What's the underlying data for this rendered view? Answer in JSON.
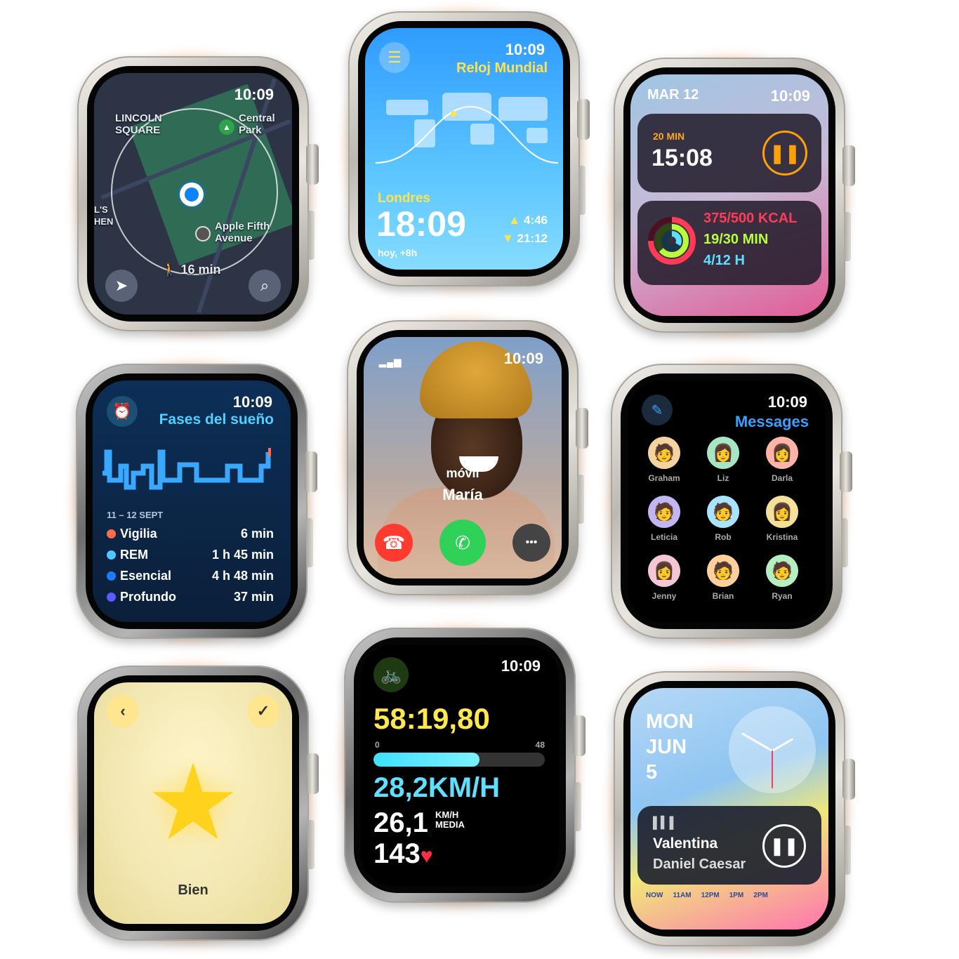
{
  "watches": {
    "maps": {
      "time": "10:09",
      "labels": [
        "LINCOLN",
        "SQUARE",
        "Central",
        "Park",
        "Apple Fifth",
        "Avenue",
        "L'S",
        "HEN"
      ],
      "route_time": "16 min",
      "icons": {
        "walk": "walk-icon",
        "locate": "location-arrow-icon",
        "search": "search-icon",
        "park": "park-pin-icon",
        "store": "apple-store-pin-icon"
      }
    },
    "world_clock": {
      "time": "10:09",
      "title": "Reloj Mundial",
      "city": "Londres",
      "city_time": "18:09",
      "offset": "hoy, +8h",
      "sunrise": "4:46",
      "sunset": "21:12"
    },
    "smart_stack": {
      "date": "MAR 12",
      "time": "10:09",
      "timer_label": "20 MIN",
      "timer_value": "15:08",
      "activity": {
        "move": "375/500 KCAL",
        "exercise": "19/30 MIN",
        "stand": "4/12 H"
      },
      "colors": {
        "move": "#ff3b57",
        "exercise": "#b8ff3b",
        "stand": "#5be1ff"
      }
    },
    "sleep": {
      "time": "10:09",
      "title": "Fases del sueño",
      "date_range": "11 – 12 SEPT",
      "stages": [
        {
          "name": "Vigilia",
          "value": "6 min",
          "color": "#ff6d4a"
        },
        {
          "name": "REM",
          "value": "1 h 45 min",
          "color": "#4fc8ff"
        },
        {
          "name": "Esencial",
          "value": "4 h 48 min",
          "color": "#1a7dff"
        },
        {
          "name": "Profundo",
          "value": "37 min",
          "color": "#5b5bff"
        }
      ]
    },
    "call": {
      "time": "10:09",
      "subtitle": "móvil",
      "name": "María",
      "more": "•••"
    },
    "messages": {
      "time": "10:09",
      "title": "Messages",
      "contacts": [
        {
          "name": "Graham",
          "emoji": "🧑",
          "bg": "#f3d3a0"
        },
        {
          "name": "Liz",
          "emoji": "👩",
          "bg": "#a7e6c2"
        },
        {
          "name": "Darla",
          "emoji": "👩",
          "bg": "#ffb3a7"
        },
        {
          "name": "Leticia",
          "emoji": "🧑",
          "bg": "#c3b5f2"
        },
        {
          "name": "Rob",
          "emoji": "🧑",
          "bg": "#a8e4ff"
        },
        {
          "name": "Kristina",
          "emoji": "👩",
          "bg": "#f5e09a"
        },
        {
          "name": "Jenny",
          "emoji": "👩",
          "bg": "#f4c7d6"
        },
        {
          "name": "Brian",
          "emoji": "🧑",
          "bg": "#ffd09a"
        },
        {
          "name": "Ryan",
          "emoji": "🧑",
          "bg": "#b5efc1"
        }
      ]
    },
    "mindfulness": {
      "word": "Bien",
      "back": "‹",
      "confirm": "✓"
    },
    "workout": {
      "time": "10:09",
      "elapsed": "58:19,80",
      "scale_min": "0",
      "scale_max": "48",
      "progress": 0.62,
      "speed": "28,2KM/H",
      "avg_value": "26,1",
      "avg_unit": "KM/H",
      "avg_label": "MEDIA",
      "heart_rate": "143"
    },
    "watch_face": {
      "day": "MON",
      "month": "JUN",
      "date": "5",
      "song": "Valentina",
      "artist": "Daniel Caesar",
      "timeline": [
        "NOW",
        "11AM",
        "12PM",
        "1PM",
        "2PM"
      ]
    }
  }
}
